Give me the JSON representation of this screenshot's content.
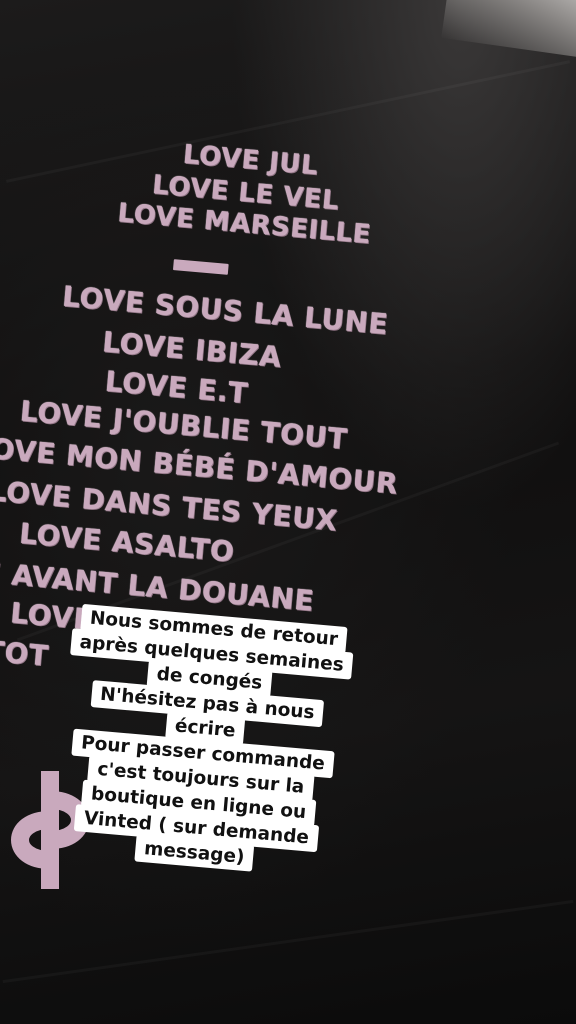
{
  "shirt_print": {
    "lines": [
      "LOVE JUL",
      "LOVE LE VEL",
      "LOVE MARSEILLE",
      "LOVE SOUS LA LUNE",
      "LOVE IBIZA",
      "LOVE E.T",
      "LOVE J'OUBLIE TOUT",
      "OVE MON BÉBÉ D'AMOUR",
      "LOVE DANS TES YEUX",
      "LOVE ASALTO",
      "E AVANT LA DOUANE",
      "LOVE MINI",
      "TOT"
    ],
    "print_color": "#c9a9bd",
    "fabric_color": "#0d0c0c"
  },
  "caption": {
    "lines": [
      "Nous sommes de retour",
      "après quelques semaines",
      "de congés",
      "N'hésitez pas à nous",
      "écrire",
      "Pour passer commande",
      "c'est toujours sur la",
      "boutique en ligne ou",
      "Vinted ( sur demande",
      "message)"
    ]
  }
}
